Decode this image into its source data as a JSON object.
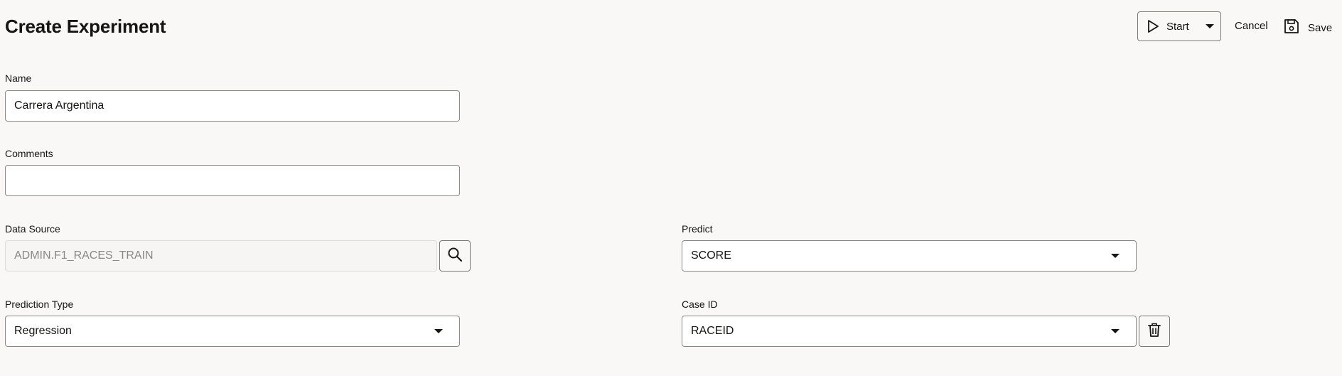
{
  "page": {
    "title": "Create Experiment"
  },
  "toolbar": {
    "start_label": "Start",
    "cancel_label": "Cancel",
    "save_label": "Save"
  },
  "form": {
    "name": {
      "label": "Name",
      "value": "Carrera Argentina"
    },
    "comments": {
      "label": "Comments",
      "value": ""
    },
    "data_source": {
      "label": "Data Source",
      "value": "ADMIN.F1_RACES_TRAIN"
    },
    "predict": {
      "label": "Predict",
      "value": "SCORE"
    },
    "prediction_type": {
      "label": "Prediction Type",
      "value": "Regression"
    },
    "case_id": {
      "label": "Case ID",
      "value": "RACEID"
    }
  },
  "icons": {
    "start": "play-icon",
    "start_menu": "caret-down-icon",
    "save": "floppy-disk-icon",
    "data_source_search": "search-icon",
    "dropdown": "caret-down-icon",
    "case_id_remove": "trash-icon"
  },
  "colors": {
    "background": "#f9f8f6",
    "text": "#161513",
    "border": "#8a8783",
    "disabled_text": "#8b8884"
  }
}
